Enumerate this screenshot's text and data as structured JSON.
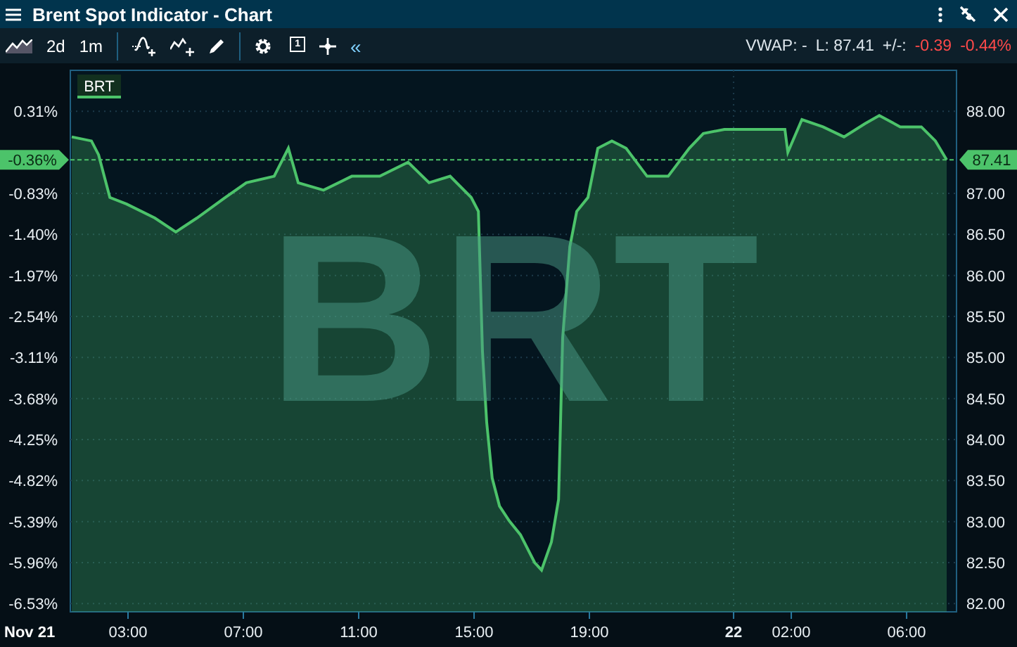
{
  "window": {
    "title": "Brent Spot Indicator - Chart"
  },
  "toolbar": {
    "range": "2d",
    "interval": "1m",
    "window_count": "1",
    "collapse": "«"
  },
  "quote": {
    "vwap": "VWAP: -",
    "last": "L: 87.41",
    "change_label": "+/-:",
    "change": "-0.39",
    "change_pct": "-0.44%"
  },
  "chart": {
    "background_label": "BRT",
    "last_tag_pct": "-0.36%",
    "last_tag_price": "87.41",
    "date_label": "Nov 21",
    "next_day_labels": [
      {
        "kind": "day",
        "text": "22"
      },
      {
        "kind": "time",
        "text": "02:00"
      },
      {
        "kind": "time",
        "text": "06:00"
      }
    ],
    "percent_labels": [
      "0.31%",
      "-0.83%",
      "-1.40%",
      "-1.97%",
      "-2.54%",
      "-3.11%",
      "-3.68%",
      "-4.25%",
      "-4.82%",
      "-5.39%",
      "-5.96%",
      "-6.53%"
    ],
    "chart_data": {
      "type": "area",
      "grid": true,
      "xlim": [
        1,
        31.73
      ],
      "ylim": [
        81.9,
        88.5
      ],
      "ref_lines": [
        {
          "axis": "y",
          "value": 87.41
        }
      ],
      "xticks": [
        {
          "value": 3,
          "label": "03:00"
        },
        {
          "value": 7,
          "label": "07:00"
        },
        {
          "value": 11,
          "label": "11:00"
        },
        {
          "value": 15,
          "label": "15:00"
        },
        {
          "value": 19,
          "label": "19:00"
        }
      ],
      "yticks": [
        {
          "value": 82,
          "label": "82.00"
        },
        {
          "value": 82.5,
          "label": "82.50"
        },
        {
          "value": 83,
          "label": "83.00"
        },
        {
          "value": 83.5,
          "label": "83.50"
        },
        {
          "value": 84,
          "label": "84.00"
        },
        {
          "value": 84.5,
          "label": "84.50"
        },
        {
          "value": 85,
          "label": "85.00"
        },
        {
          "value": 85.5,
          "label": "85.50"
        },
        {
          "value": 86,
          "label": "86.00"
        },
        {
          "value": 86.5,
          "label": "86.50"
        },
        {
          "value": 87,
          "label": "87.00"
        },
        {
          "value": 88,
          "label": "88.00"
        }
      ],
      "x": [
        1.05,
        1.73,
        1.98,
        2.37,
        2.95,
        3.93,
        4.66,
        5.39,
        6.37,
        7.1,
        8.07,
        8.56,
        8.9,
        9.78,
        10.76,
        11.73,
        12.71,
        13.44,
        14.17,
        14.9,
        15.15,
        15.29,
        15.44,
        15.63,
        15.88,
        16.22,
        16.61,
        17.1,
        17.34,
        17.68,
        17.93,
        18.07,
        18.32,
        18.56,
        18.95,
        19.29,
        19.78,
        20.27,
        21.0,
        21.73,
        22.46,
        22.95,
        23.68,
        25.78,
        25.88,
        26.37,
        27.1,
        27.83,
        28.56,
        29.05,
        29.78,
        30.51,
        31.0,
        31.39
      ],
      "series": [
        {
          "name": "BRT",
          "color": "#4cc36a",
          "values": [
            87.69,
            87.64,
            87.47,
            86.95,
            86.87,
            86.7,
            86.53,
            86.7,
            86.95,
            87.13,
            87.21,
            87.55,
            87.13,
            87.04,
            87.21,
            87.21,
            87.38,
            87.13,
            87.21,
            86.95,
            86.78,
            85.07,
            84.21,
            83.53,
            83.19,
            83.01,
            82.84,
            82.5,
            82.41,
            82.75,
            83.27,
            85.24,
            86.35,
            86.78,
            86.95,
            87.55,
            87.64,
            87.55,
            87.21,
            87.21,
            87.55,
            87.73,
            87.78,
            87.78,
            87.5,
            87.9,
            87.81,
            87.69,
            87.85,
            87.95,
            87.81,
            87.81,
            87.64,
            87.41
          ]
        }
      ]
    }
  }
}
